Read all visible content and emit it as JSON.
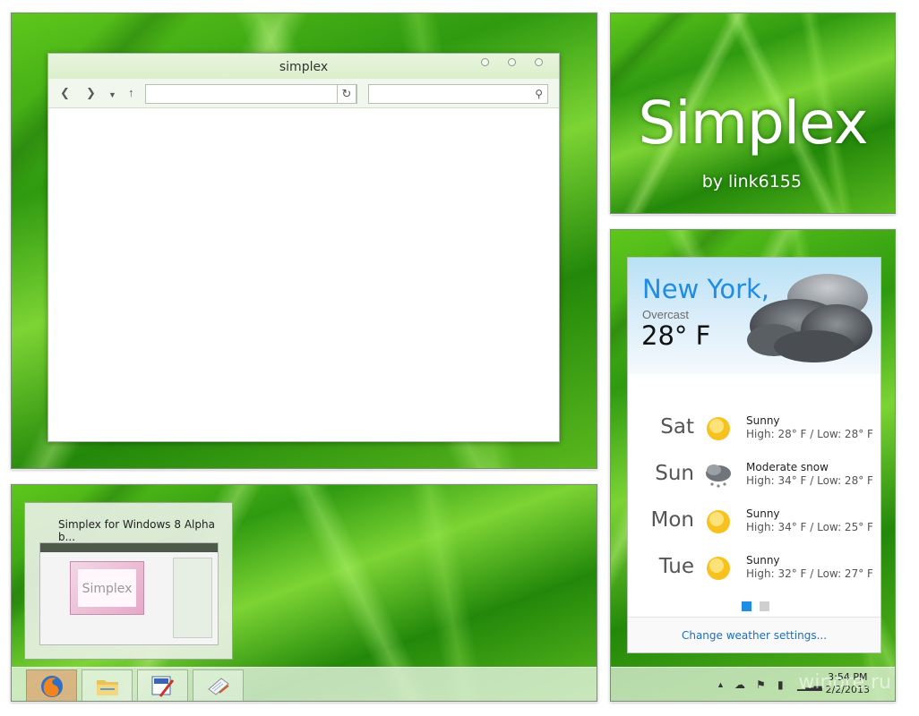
{
  "window_demo": {
    "title": "simplex"
  },
  "title_card": {
    "title": "Simplex",
    "byline": "by link6155"
  },
  "weather": {
    "city": "New York,",
    "condition": "Overcast",
    "temperature": "28° F",
    "forecast": [
      {
        "day": "Sat",
        "icon": "sun-icon",
        "condition": "Sunny",
        "hilo": "High: 28° F / Low: 28° F"
      },
      {
        "day": "Sun",
        "icon": "snow-cloud-icon",
        "condition": "Moderate snow",
        "hilo": "High: 34° F / Low: 28° F"
      },
      {
        "day": "Mon",
        "icon": "sun-icon",
        "condition": "Sunny",
        "hilo": "High: 34° F / Low: 25° F"
      },
      {
        "day": "Tue",
        "icon": "sun-icon",
        "condition": "Sunny",
        "hilo": "High: 32° F / Low: 27° F"
      }
    ],
    "page_indicator": {
      "count": 2,
      "active": 0
    },
    "settings_link": "Change weather settings...",
    "accent_color": "#1e8de3"
  },
  "system_tray": {
    "time": "3:54 PM",
    "date": "2/2/2013",
    "watermark": "winore.ru"
  },
  "taskbar_demo": {
    "thumbnail_title": "Simplex for Windows 8 Alpha b...",
    "thumbnail_preview_text": "Simplex",
    "buttons": [
      {
        "name": "firefox",
        "icon": "firefox-icon"
      },
      {
        "name": "file-explorer",
        "icon": "folder-icon"
      },
      {
        "name": "paint",
        "icon": "paint-icon"
      },
      {
        "name": "notepad",
        "icon": "notepad-icon"
      }
    ]
  }
}
